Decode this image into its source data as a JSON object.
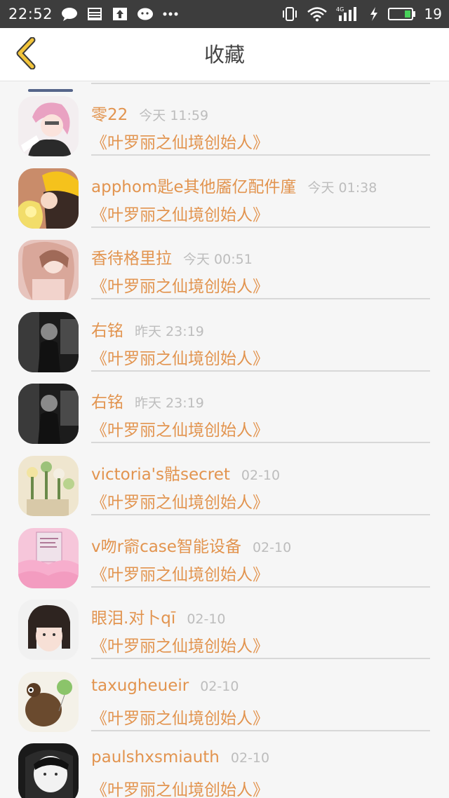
{
  "status_bar": {
    "time": "22:52",
    "battery_level": "19",
    "network_label": "4G",
    "icons": [
      "message-icon",
      "news-icon",
      "upload-icon",
      "wechat-icon",
      "more-dots-icon",
      "vibrate-icon",
      "wifi-icon",
      "signal-icon",
      "charging-icon",
      "battery-icon"
    ]
  },
  "header": {
    "title": "收藏",
    "back_icon": "chevron-left-icon"
  },
  "colors": {
    "accent": "#e2944f",
    "back_arrow": "#f2c43a",
    "time_text": "#bdbdbd",
    "status_bar": "#3d3d3d"
  },
  "items": [
    {
      "name": "零22",
      "time": "今天 11:59",
      "subtitle": "《叶罗丽之仙境创始人》",
      "avatar": "pink-hair-anime-avatar"
    },
    {
      "name": "apphom匙e其他靥亿配件廑",
      "time": "今天 01:38",
      "subtitle": "《叶罗丽之仙境创始人》",
      "avatar": "yellow-hat-girl-avatar"
    },
    {
      "name": "香待格里拉",
      "time": "今天 00:51",
      "subtitle": "《叶罗丽之仙境创始人》",
      "avatar": "blonde-girl-avatar"
    },
    {
      "name": "右铭",
      "time": "昨天 23:19",
      "subtitle": "《叶罗丽之仙境创始人》",
      "avatar": "dark-anime-avatar"
    },
    {
      "name": "右铭",
      "time": "昨天 23:19",
      "subtitle": "《叶罗丽之仙境创始人》",
      "avatar": "dark-anime-avatar"
    },
    {
      "name": "victoria's骷secret",
      "time": "02-10",
      "subtitle": "《叶罗丽之仙境创始人》",
      "avatar": "flower-pens-avatar"
    },
    {
      "name": "v吻r窬case智能设备",
      "time": "02-10",
      "subtitle": "《叶罗丽之仙境创始人》",
      "avatar": "pink-card-avatar"
    },
    {
      "name": "眼泪.对卜qī",
      "time": "02-10",
      "subtitle": "《叶罗丽之仙境创始人》",
      "avatar": "bob-hair-girl-avatar"
    },
    {
      "name": "taxugheueir",
      "time": "02-10",
      "subtitle": "《叶罗丽之仙境创始人》",
      "avatar": "bear-balloon-avatar"
    },
    {
      "name": "paulshxsmiauth",
      "time": "02-10",
      "subtitle": "《叶罗丽之仙境创始人》",
      "avatar": "pale-face-avatar"
    }
  ]
}
